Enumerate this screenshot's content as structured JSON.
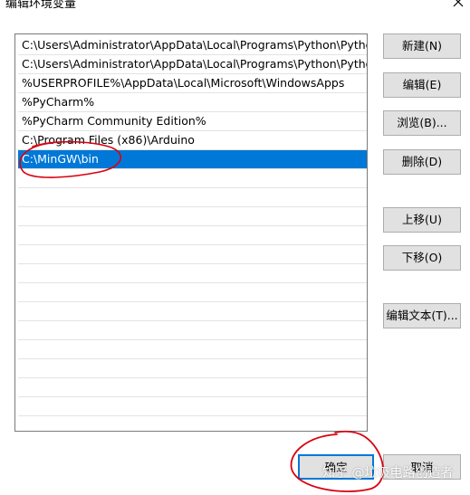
{
  "window": {
    "title": "编辑环境变量",
    "close_icon": "close-icon"
  },
  "path_list": [
    "C:\\Users\\Administrator\\AppData\\Local\\Programs\\Python\\Pytho...",
    "C:\\Users\\Administrator\\AppData\\Local\\Programs\\Python\\Pytho...",
    "%USERPROFILE%\\AppData\\Local\\Microsoft\\WindowsApps",
    "%PyCharm%",
    "%PyCharm Community Edition%",
    "C:\\Program Files (x86)\\Arduino",
    "C:\\MinGW\\bin",
    "",
    "",
    "",
    "",
    "",
    "",
    "",
    "",
    "",
    "",
    "",
    "",
    "",
    ""
  ],
  "selected_index": 6,
  "buttons": {
    "new": "新建(N)",
    "edit": "编辑(E)",
    "browse": "浏览(B)...",
    "delete": "删除(D)",
    "move_up": "上移(U)",
    "move_down": "下移(O)",
    "edit_text": "编辑文本(T)...",
    "ok": "确定",
    "cancel": "取消"
  },
  "watermark": "知乎 @垃圾电路创造者",
  "colors": {
    "selection": "#0078d7",
    "annotation": "#d9000f",
    "button_face": "#e1e1e1"
  }
}
